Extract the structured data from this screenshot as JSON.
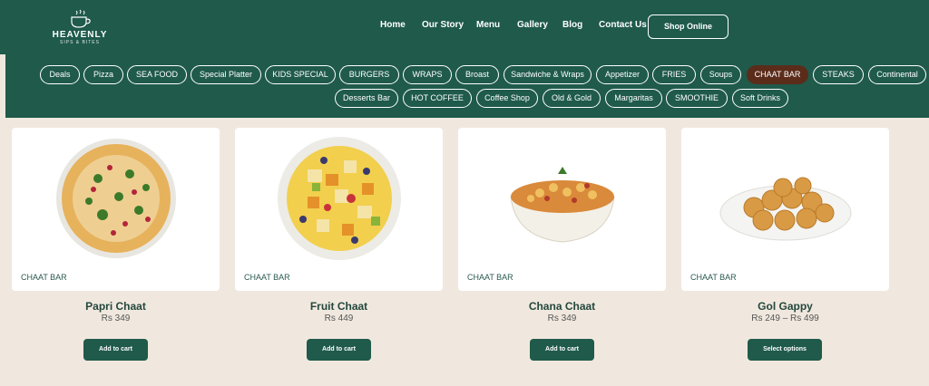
{
  "brand": {
    "name": "HEAVENLY",
    "tagline": "SIPS & BITES"
  },
  "nav": {
    "items": [
      "Home",
      "Our Story",
      "Menu",
      "Gallery",
      "Blog",
      "Contact Us"
    ],
    "cta": "Shop Online"
  },
  "categories": {
    "row1": [
      "Deals",
      "Pizza",
      "SEA FOOD",
      "Special Platter",
      "KIDS SPECIAL",
      "BURGERS",
      "WRAPS",
      "Broast",
      "Sandwiche & Wraps",
      "Appetizer",
      "FRIES",
      "Soups",
      "CHAAT BAR",
      "STEAKS",
      "Continental"
    ],
    "row2": [
      "Desserts Bar",
      "HOT COFFEE",
      "Coffee Shop",
      "Old & Gold",
      "Margaritas",
      "SMOOTHIE",
      "Soft Drinks"
    ],
    "active": "CHAAT BAR"
  },
  "products": [
    {
      "category": "CHAAT BAR",
      "name": "Papri Chaat",
      "price": "Rs 349",
      "button": "Add to cart",
      "image": "papri-chaat-image"
    },
    {
      "category": "CHAAT BAR",
      "name": "Fruit Chaat",
      "price": "Rs 449",
      "button": "Add to cart",
      "image": "fruit-chaat-image"
    },
    {
      "category": "CHAAT BAR",
      "name": "Chana Chaat",
      "price": "Rs 349",
      "button": "Add to cart",
      "image": "chana-chaat-image"
    },
    {
      "category": "CHAAT BAR",
      "name": "Gol Gappy",
      "price": "Rs 249 – Rs 499",
      "button": "Select options",
      "image": "gol-gappy-image"
    }
  ],
  "colors": {
    "header": "#1f5a4b",
    "active_pill": "#5b2c1a",
    "page_bg": "#f0e8de",
    "button": "#1f5a4b"
  }
}
